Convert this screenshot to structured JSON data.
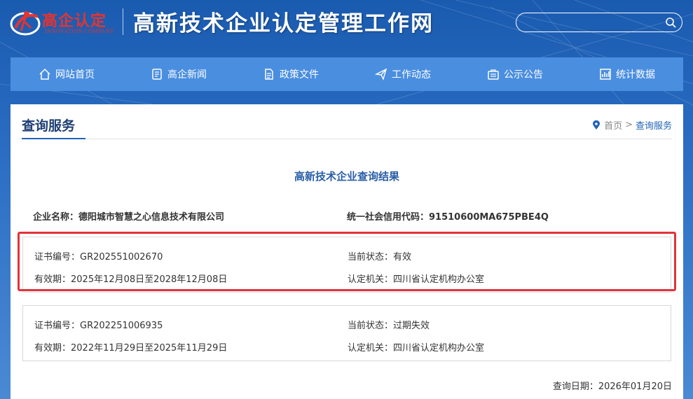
{
  "header": {
    "logo_text": "高企认定",
    "logo_sub": "INNOVATION COMPANY",
    "site_title": "高新技术企业认定管理工作网",
    "search_placeholder": ""
  },
  "nav": {
    "items": [
      {
        "label": "网站首页",
        "icon": "home-icon"
      },
      {
        "label": "高企新闻",
        "icon": "news-icon"
      },
      {
        "label": "政策文件",
        "icon": "document-icon"
      },
      {
        "label": "工作动态",
        "icon": "paper-plane-icon"
      },
      {
        "label": "公示公告",
        "icon": "notice-icon"
      },
      {
        "label": "统计数据",
        "icon": "chart-icon"
      }
    ]
  },
  "section": {
    "title": "查询服务",
    "breadcrumb_home": "首页",
    "breadcrumb_sep": ">",
    "breadcrumb_current": "查询服务"
  },
  "result": {
    "title": "高新技术企业查询结果",
    "company_name": "企业名称：德阳城市智慧之心信息技术有限公司",
    "credit_code": "统一社会信用代码：91510600MA675PBE4Q",
    "certificates": [
      {
        "cert_no": "证书编号：GR202551002670",
        "status": "当前状态：有效",
        "validity": "有效期：2025年12月08日至2028年12月08日",
        "authority": "认定机关：四川省认定机构办公室"
      },
      {
        "cert_no": "证书编号：GR202251006935",
        "status": "当前状态：过期失效",
        "validity": "有效期：2022年11月29日至2025年11月29日",
        "authority": "认定机关：四川省认定机构办公室"
      }
    ],
    "query_date": "查询日期：2026年01月20日"
  },
  "colors": {
    "nav_bg": "#4a8ee0",
    "accent": "#1f62b8",
    "highlight": "#e0343a",
    "logo_red": "#e8332d"
  }
}
